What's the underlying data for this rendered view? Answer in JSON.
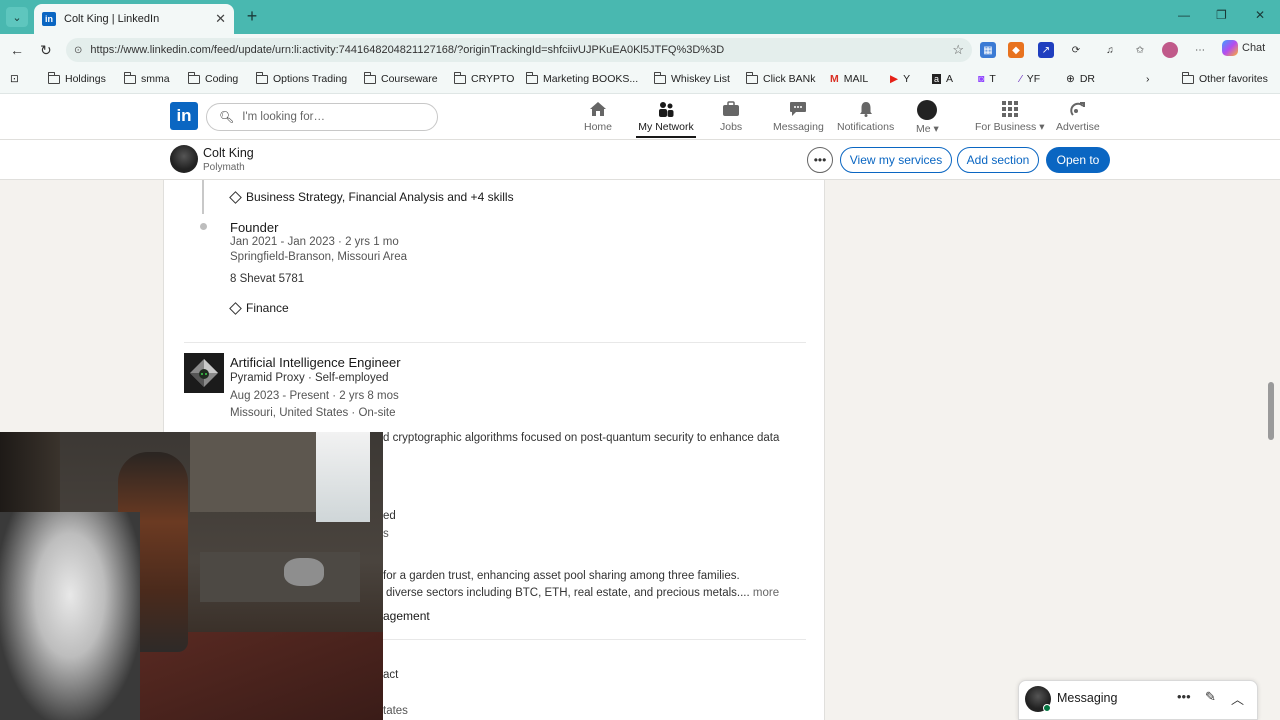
{
  "browser": {
    "tab_title": "Colt King | LinkedIn",
    "url": "https://www.linkedin.com/feed/update/urn:li:activity:7441648204821127168/?originTrackingId=shfciivUJPKuEA0Kl5JTFQ%3D%3D",
    "chat_label": "Chat",
    "bookmarks": [
      "Holdings",
      "smma",
      "Coding",
      "Options Trading",
      "Courseware",
      "CRYPTO",
      "Marketing BOOKS...",
      "Whiskey List",
      "Click BANk",
      "MAIL",
      "Y",
      "A",
      "T",
      "YF",
      "DR"
    ],
    "other_favorites": "Other favorites"
  },
  "linkedin": {
    "search_placeholder": "I'm looking for…",
    "nav": {
      "home": "Home",
      "network": "My Network",
      "jobs": "Jobs",
      "messaging": "Messaging",
      "notifications": "Notifications",
      "me": "Me",
      "business": "For Business",
      "advertise": "Advertise"
    }
  },
  "profile": {
    "name": "Colt King",
    "headline": "Polymath",
    "buttons": {
      "more": "•••",
      "view_services": "View my services",
      "add_section": "Add section",
      "open_to": "Open to"
    }
  },
  "experience": {
    "skills_line_1": "Business Strategy, Financial Analysis and +4 skills",
    "founder": {
      "title": "Founder",
      "dates": "Jan 2021 - Jan 2023 · 2 yrs 1 mo",
      "location": "Springfield-Branson, Missouri Area",
      "note": "8 Shevat 5781",
      "skill": "Finance"
    },
    "ai_engineer": {
      "title": "Artificial Intelligence Engineer",
      "company": "Pyramid Proxy · Self-employed",
      "dates": "Aug 2023 - Present · 2 yrs 8 mos",
      "location": "Missouri, United States · On-site",
      "description_fragment": "d cryptographic algorithms focused on post-quantum security to enhance data"
    },
    "partial": {
      "line_a": "ed",
      "line_b": "s",
      "desc_1": "for a garden trust, enhancing asset pool sharing among three families.",
      "desc_2": "diverse sectors including BTC, ETH, real estate, and precious metals....",
      "more": "more",
      "skill": "agement",
      "line_c": "act",
      "line_d": "tates"
    }
  },
  "messaging_widget": {
    "label": "Messaging"
  }
}
